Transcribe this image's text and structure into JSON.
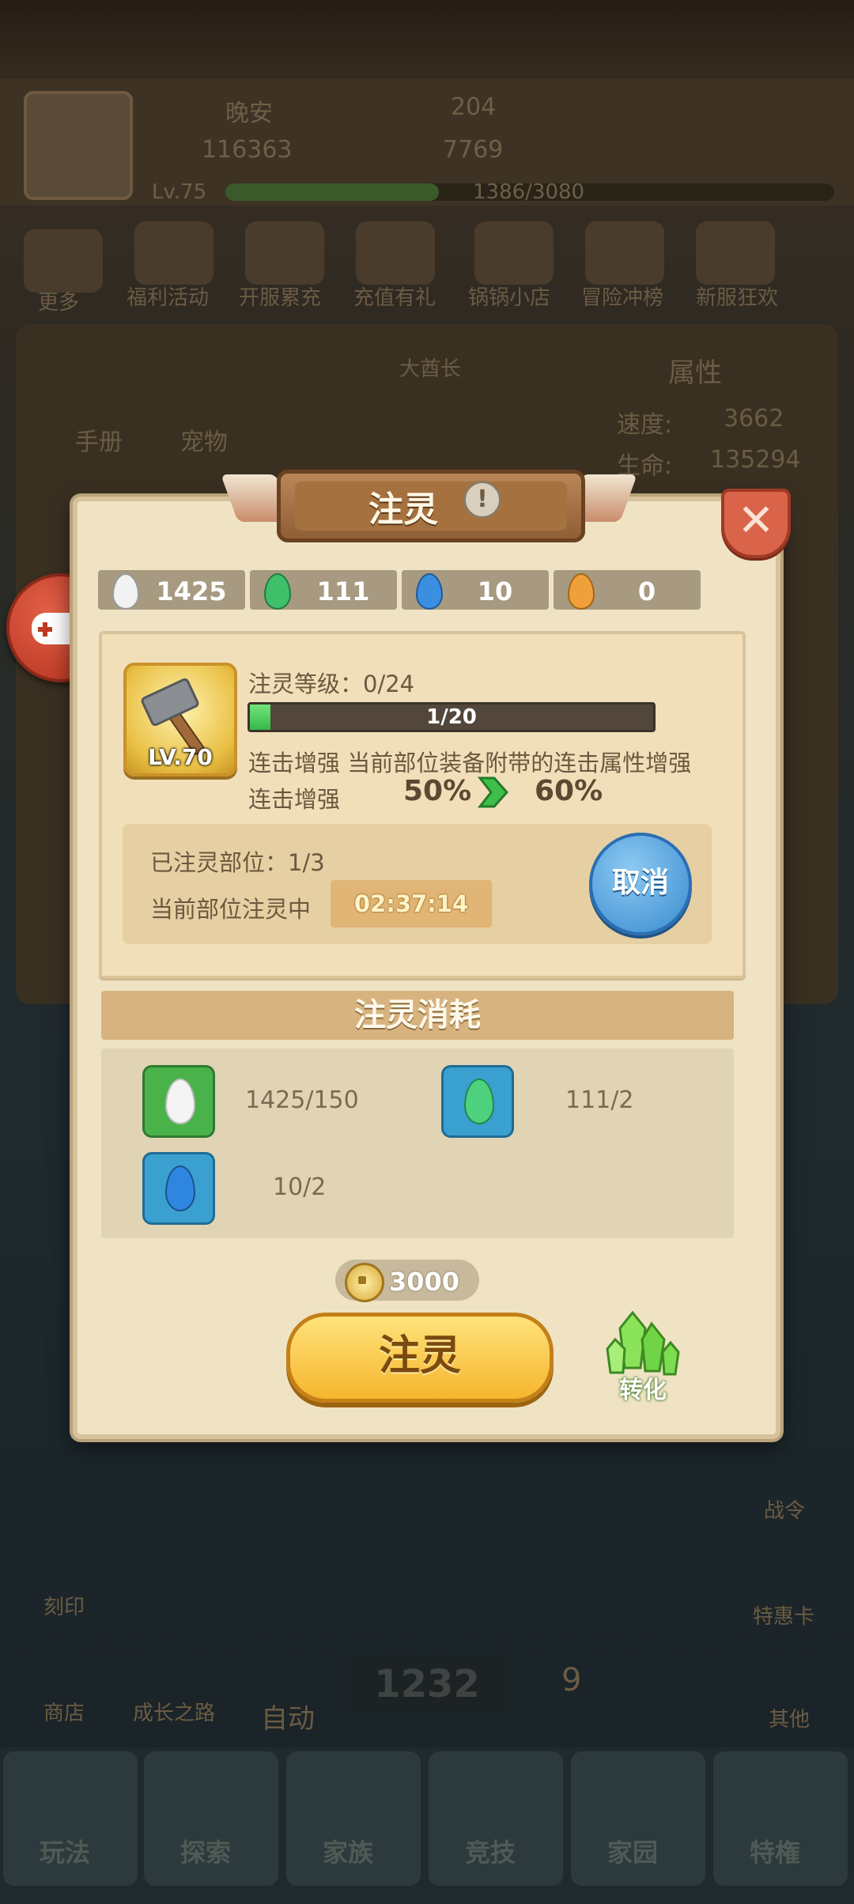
{
  "background": {
    "player": {
      "name": "晚安",
      "coins": "116363",
      "gems": "204",
      "food": "7769",
      "level": "Lv.75",
      "exp": "1386/3080"
    },
    "menu_icons": [
      "更多",
      "福利活动",
      "开服累充",
      "充值有礼",
      "锅锅小店",
      "冒险冲榜",
      "新服狂欢"
    ],
    "side_left": [
      "手册",
      "宠物"
    ],
    "center_banner": "大酋长",
    "attr_panel": {
      "title": "属性",
      "rows": [
        {
          "k": "速度:",
          "v": "3662"
        },
        {
          "k": "生命:",
          "v": "135294"
        }
      ]
    },
    "right_buttons": [
      "战令",
      "特惠卡",
      "其他"
    ],
    "left_buttons": [
      "刻印",
      "商店",
      "成长之路",
      "自动"
    ],
    "center_value": "1232",
    "turn_badge": "9",
    "bottom_nav": [
      "玩法",
      "探索",
      "家族",
      "竞技",
      "家园",
      "特権"
    ]
  },
  "dialog": {
    "title": "注灵",
    "info_icon": "!",
    "close": "✕",
    "currencies": [
      {
        "value": "1425",
        "color": "#f2f2f2"
      },
      {
        "value": "111",
        "color": "#3fbf6a"
      },
      {
        "value": "10",
        "color": "#3b8fe0"
      },
      {
        "value": "0",
        "color": "#f0a03a"
      }
    ],
    "item": {
      "level_badge": "LV.70",
      "icon": "hammer-icon"
    },
    "level_label": "注灵等级：0/24",
    "progress": {
      "text": "1/20",
      "fraction": 0.05
    },
    "description": "连击增强 当前部位装备附带的连击属性增强",
    "stat_name": "连击增强",
    "stat_from": "50%",
    "stat_to": "60%",
    "infused_parts": "已注灵部位：1/3",
    "current_part": "当前部位注灵中",
    "timer": "02:37:14",
    "cancel": "取消",
    "consumption_title": "注灵消耗",
    "materials": [
      {
        "value": "1425/150",
        "box": "#4ab24a",
        "drop": "#f4f4f4"
      },
      {
        "value": "111/2",
        "box": "#3aa0d0",
        "drop": "#4ed17c"
      },
      {
        "value": "10/2",
        "box": "#3aa0d0",
        "drop": "#2f86e0"
      }
    ],
    "cost": "3000",
    "action": "注灵",
    "convert": "转化"
  },
  "colors": {
    "panel": "#efe3c4",
    "accent_gold": "#f6b52e",
    "accent_blue": "#3a8ad0",
    "close_red": "#d9644a"
  }
}
